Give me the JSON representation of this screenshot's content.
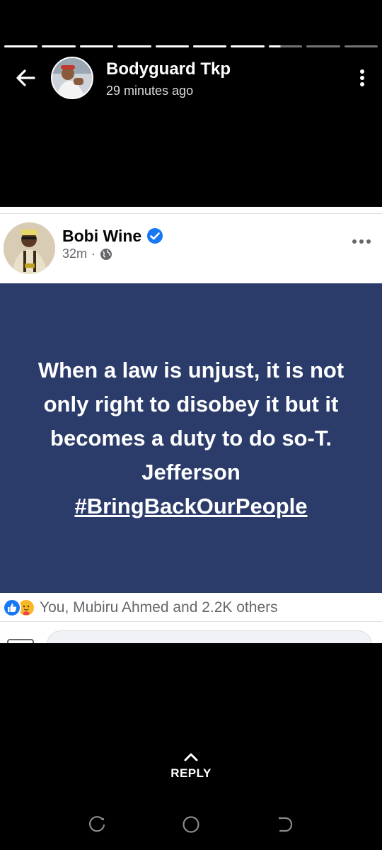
{
  "story": {
    "segments": [
      "full",
      "full",
      "full",
      "full",
      "full",
      "full",
      "full",
      "partial",
      "empty",
      "empty"
    ],
    "author_name": "Bodyguard Tkp",
    "time_ago": "29 minutes ago"
  },
  "post": {
    "author_name": "Bobi Wine",
    "time": "32m",
    "separator": "·",
    "quote": "When a law is unjust, it is not only right to disobey it but it becomes a duty to do so-T. Jefferson",
    "hashtag": "#BringBackOurPeople",
    "reactions_text": "You, Mubiru Ahmed and 2.2K others"
  },
  "reply": {
    "label": "REPLY"
  },
  "colors": {
    "quote_background": "#2b3c6b",
    "facebook_blue": "#1877f2",
    "muted_text": "#65676b"
  },
  "icons": [
    "back-arrow-icon",
    "more-vertical-icon",
    "verified-badge-icon",
    "globe-icon",
    "more-horizontal-icon",
    "like-reaction-icon",
    "care-reaction-icon",
    "chevron-up-icon",
    "recent-apps-icon",
    "home-icon",
    "back-nav-icon"
  ]
}
